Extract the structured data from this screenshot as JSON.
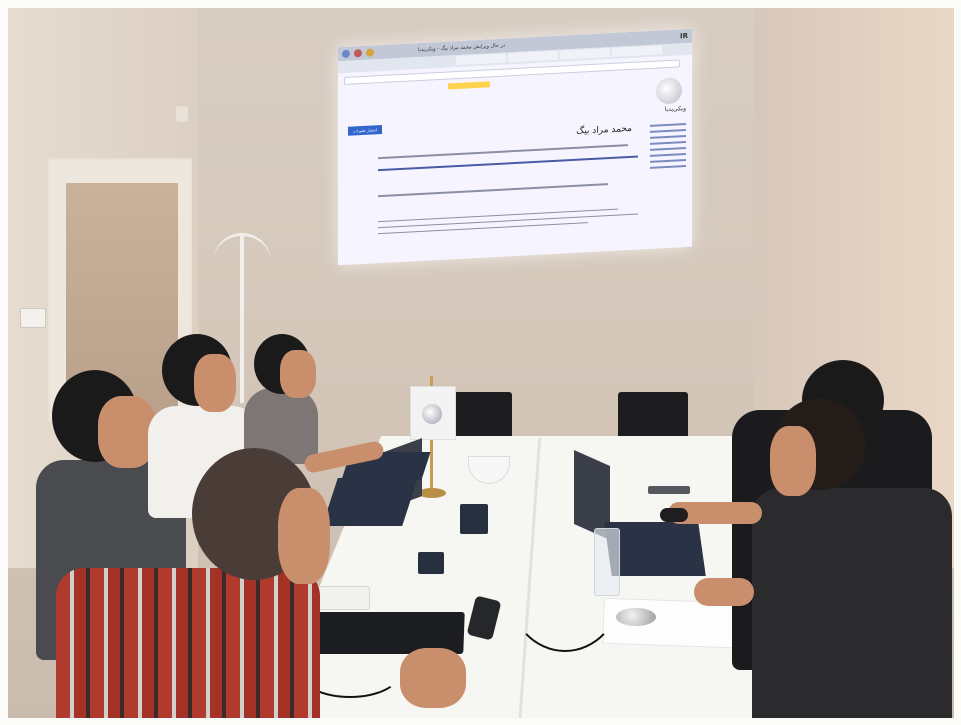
{
  "scene": {
    "description_tags": [
      "meeting-room",
      "projector",
      "laptops",
      "people"
    ],
    "projection": {
      "taskbar_title": "در حال ویرایش محمد مراد بیگ - ویکی‌پدیا",
      "status": "IR",
      "wiki_name": "ویکی‌پدیا",
      "heading": "محمد مراد بیگ",
      "save_label": "انتشار تغییرات"
    }
  },
  "colors": {
    "wall": "#d5c8bb",
    "projection_bg": "#f6f4ff",
    "table": "#f6f6f3",
    "dark": "#1c1d20",
    "wiki_blue": "#3366cc"
  }
}
